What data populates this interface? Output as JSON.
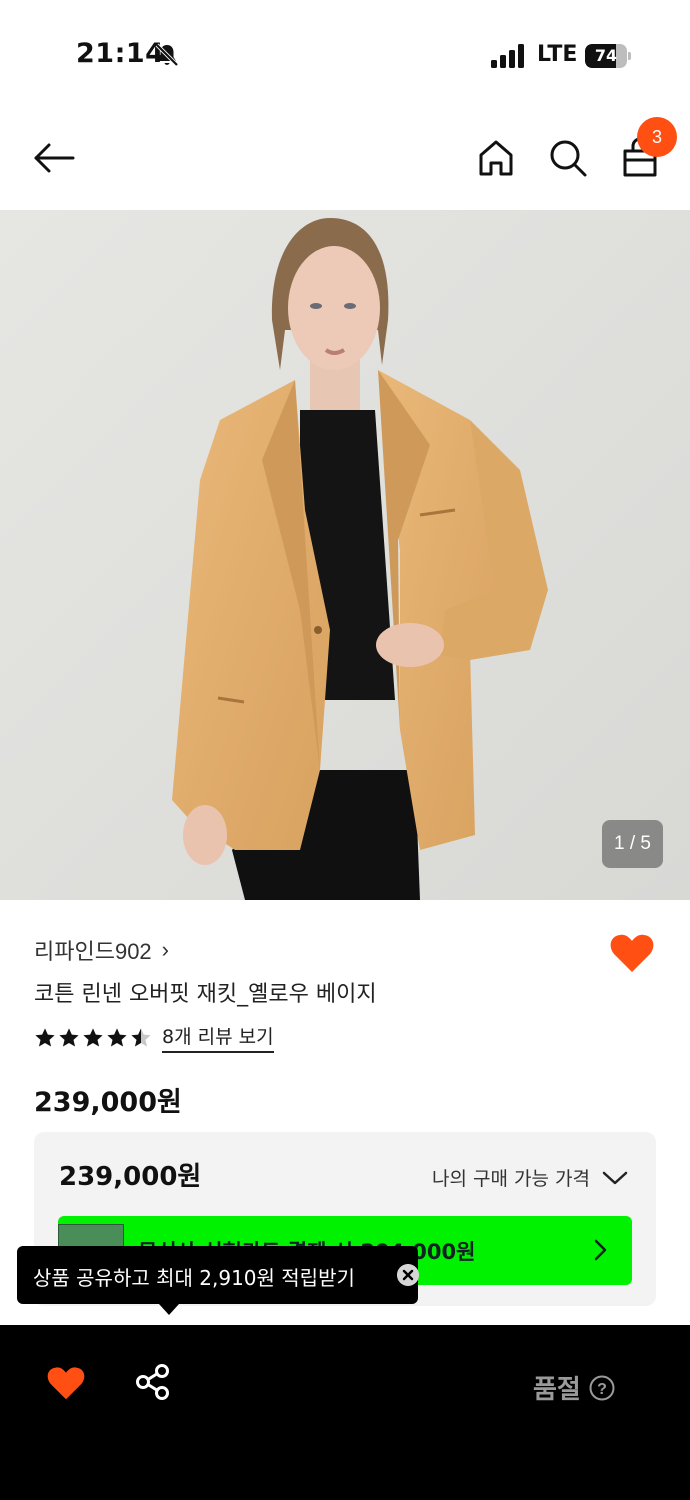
{
  "status_bar": {
    "time": "21:14",
    "network": "LTE",
    "battery": "74",
    "battery_level_percent": 74,
    "icons": [
      "bell-muted-icon",
      "signal-icon",
      "battery-icon"
    ]
  },
  "header": {
    "icons": [
      "back-arrow-icon",
      "home-icon",
      "search-icon",
      "shopping-bag-icon"
    ],
    "cart_count": "3",
    "accent_color": "#ff4f12"
  },
  "gallery": {
    "counter": "1 / 5"
  },
  "product": {
    "brand": "리파인드902",
    "brand_chevron": "›",
    "name": "코튼 린넨 오버핏 재킷_옐로우 베이지",
    "rating": 4.5,
    "rating_max": 5,
    "review_link": "8개 리뷰 보기",
    "price": "239,000원"
  },
  "price_box": {
    "price": "239,000원",
    "label": "나의 구매 가능 가격",
    "card_promo": "무신사 신현카드 결제 시 204,000원",
    "card_color": "#00f200"
  },
  "tooltip": {
    "text": "상품 공유하고 최대 2,910원 적립받기"
  },
  "bottom_bar": {
    "status": "품절",
    "help_glyph": "?"
  }
}
